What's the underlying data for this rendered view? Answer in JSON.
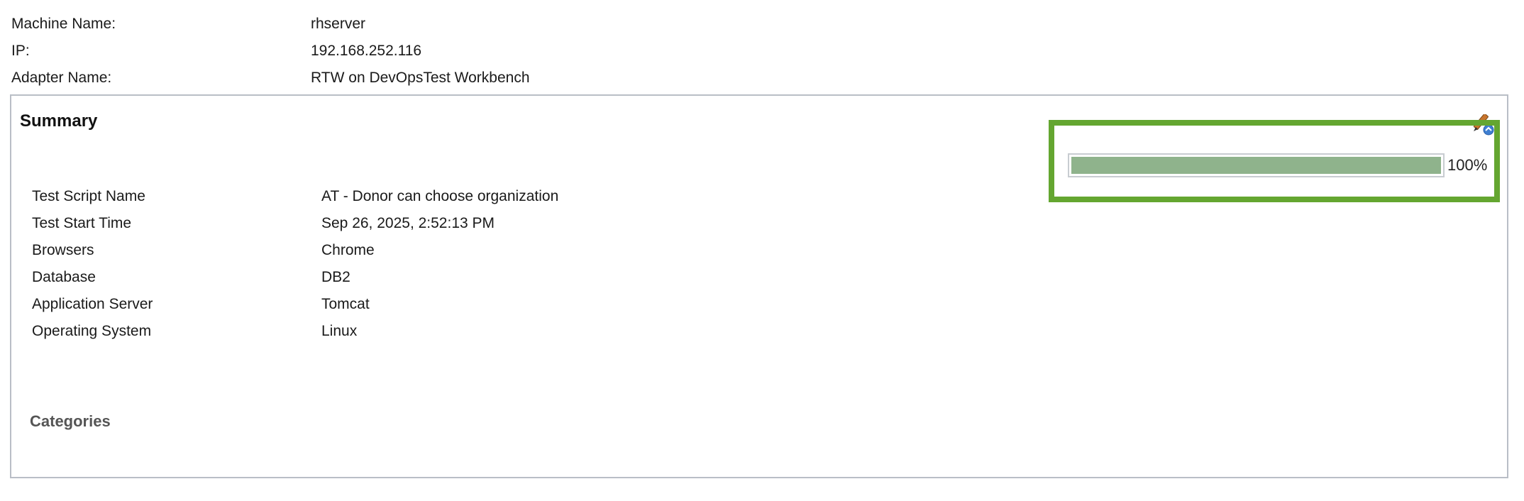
{
  "machine_info": [
    {
      "label": "Machine Name:",
      "value": "rhserver"
    },
    {
      "label": "IP:",
      "value": "192.168.252.116"
    },
    {
      "label": "Adapter Name:",
      "value": "RTW on DevOpsTest Workbench"
    }
  ],
  "summary": {
    "title": "Summary",
    "progress": {
      "value": 1.0,
      "text": "100%"
    },
    "details": [
      {
        "label": "Test Script Name",
        "value": "AT - Donor can choose organization"
      },
      {
        "label": "Test Start Time",
        "value": "Sep 26, 2025, 2:52:13 PM"
      },
      {
        "label": "Browsers",
        "value": "Chrome"
      },
      {
        "label": "Database",
        "value": "DB2"
      },
      {
        "label": "Application Server",
        "value": "Tomcat"
      },
      {
        "label": "Operating System",
        "value": "Linux"
      }
    ],
    "categories_heading": "Categories"
  },
  "icons": {
    "edit": "pencil-edit-icon"
  },
  "colors": {
    "progress_fill": "#8fb38c",
    "highlight": "#64a630",
    "panel_border": "#b9bec6"
  }
}
